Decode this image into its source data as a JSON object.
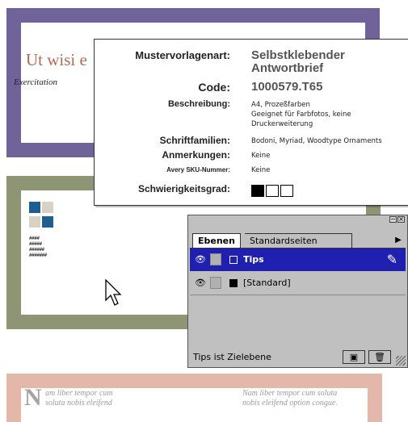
{
  "templates": {
    "purple_card": {
      "title": "Ut wisi e",
      "subtitle": "Exercitation",
      "color": "#6f6399"
    },
    "olive_card": {
      "color": "#8e9574",
      "swatch_glyphs": [
        "░",
        "░",
        "░",
        "░"
      ],
      "bar_rows": [
        "####",
        "#####",
        "######",
        "#######"
      ]
    },
    "salmon_card": {
      "color": "#e3b8ab",
      "dropcap": "N",
      "text_left": [
        "am liber tempor cum",
        "soluta nobis eleifend"
      ],
      "text_right": [
        "Nam liber tempor cum soluta",
        "nobis eleifend option congue."
      ]
    }
  },
  "info": {
    "rows": [
      {
        "label": "Mustervorlagenart:",
        "value": "Selbstklebender Antwortbrief"
      },
      {
        "label": "Code:",
        "value": "1000579.T65"
      },
      {
        "label": "Beschreibung:",
        "value": [
          "A4, Prozeßfarben",
          "Geeignet für Farbfotos, keine",
          "Druckerweiterung"
        ]
      },
      {
        "label": "Schriftfamilien:",
        "value": "Bodoni, Myriad, Woodtype Ornaments"
      },
      {
        "label": "Anmerkungen:",
        "value": "Keine"
      },
      {
        "label": "Avery SKU-Nummer:",
        "value": "Keine"
      },
      {
        "label": "Schwierigkeitsgrad:",
        "value": "",
        "level": 1,
        "max": 3
      }
    ]
  },
  "palette": {
    "tabs": [
      "Ebenen",
      "Standardseiten"
    ],
    "layers": [
      {
        "name": "Tips",
        "selected": true,
        "color": "#2020b0"
      },
      {
        "name": "[Standard]",
        "selected": false,
        "color": "#000000"
      }
    ],
    "status": "Tips ist Zielebene",
    "icons": {
      "eye": "eye-icon",
      "lock": "lock-icon",
      "pen": "pen-icon",
      "new_layer": "new-layer-icon",
      "trash": "trash-icon"
    }
  }
}
